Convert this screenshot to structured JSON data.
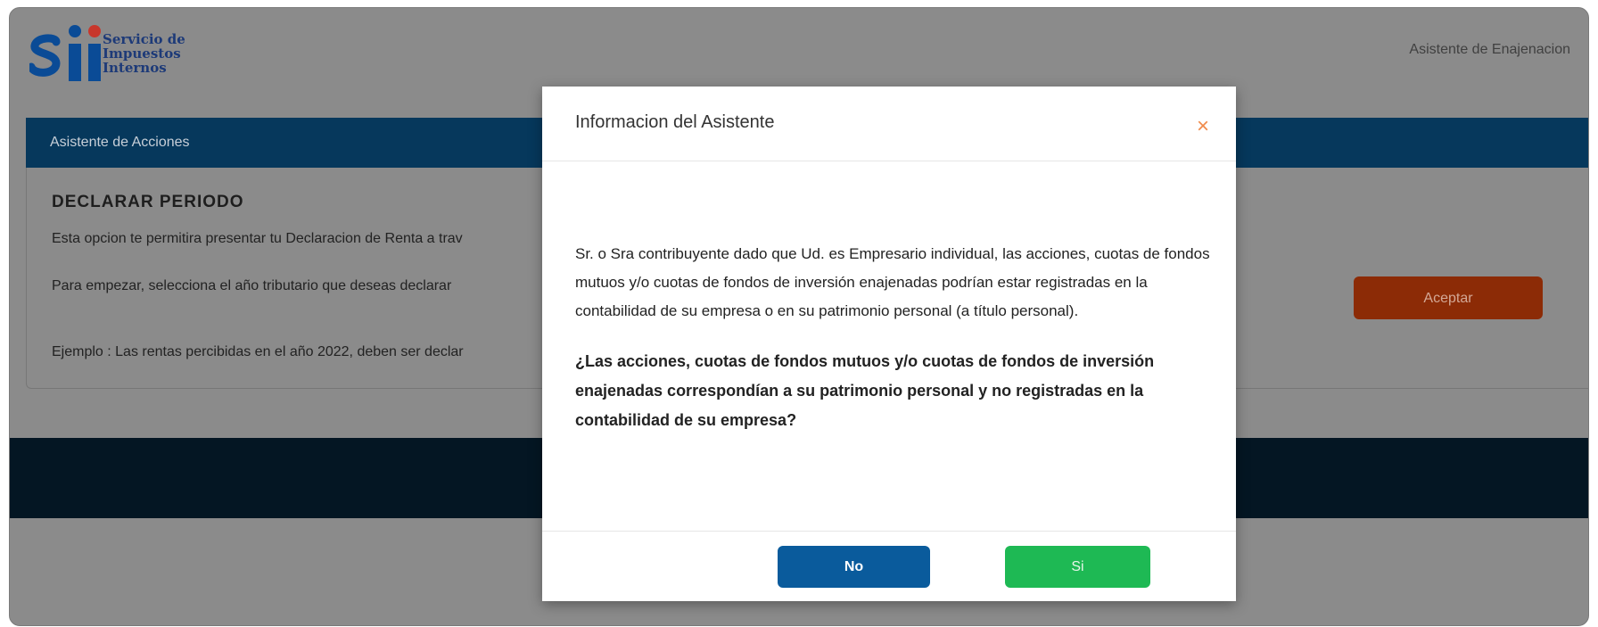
{
  "header": {
    "logo_lines": [
      "Servicio de",
      "Impuestos",
      "Internos"
    ],
    "right_title": "Asistente de Enajenacion"
  },
  "acc_bar": {
    "title": "Asistente de Acciones"
  },
  "card": {
    "title": "DECLARAR PERIODO",
    "p1": "Esta opcion te permitira presentar tu Declaracion de Renta a trav",
    "p2": "Para empezar, selecciona el año tributario que deseas declarar",
    "p3": "Ejemplo : Las rentas percibidas en el año 2022, deben ser declar",
    "accept_label": "Aceptar"
  },
  "modal": {
    "title": "Informacion del Asistente",
    "close_glyph": "×",
    "text": "Sr. o Sra contribuyente dado que Ud. es Empresario individual, las acciones, cuotas de fondos mutuos y/o cuotas de fondos de inversión enajenadas podrían estar registradas en la contabilidad de su empresa o en su patrimonio personal (a título personal).",
    "question": "¿Las acciones, cuotas de fondos mutuos y/o cuotas de fondos de inversión enajenadas correspondían a su patrimonio personal y no registradas en la contabilidad de su empresa?",
    "no_label": "No",
    "si_label": "Si"
  },
  "colors": {
    "brand_blue": "#06385c",
    "accept": "#8c2b06",
    "no": "#0a5b9c",
    "si": "#1eb954",
    "close": "#f08a4b"
  }
}
